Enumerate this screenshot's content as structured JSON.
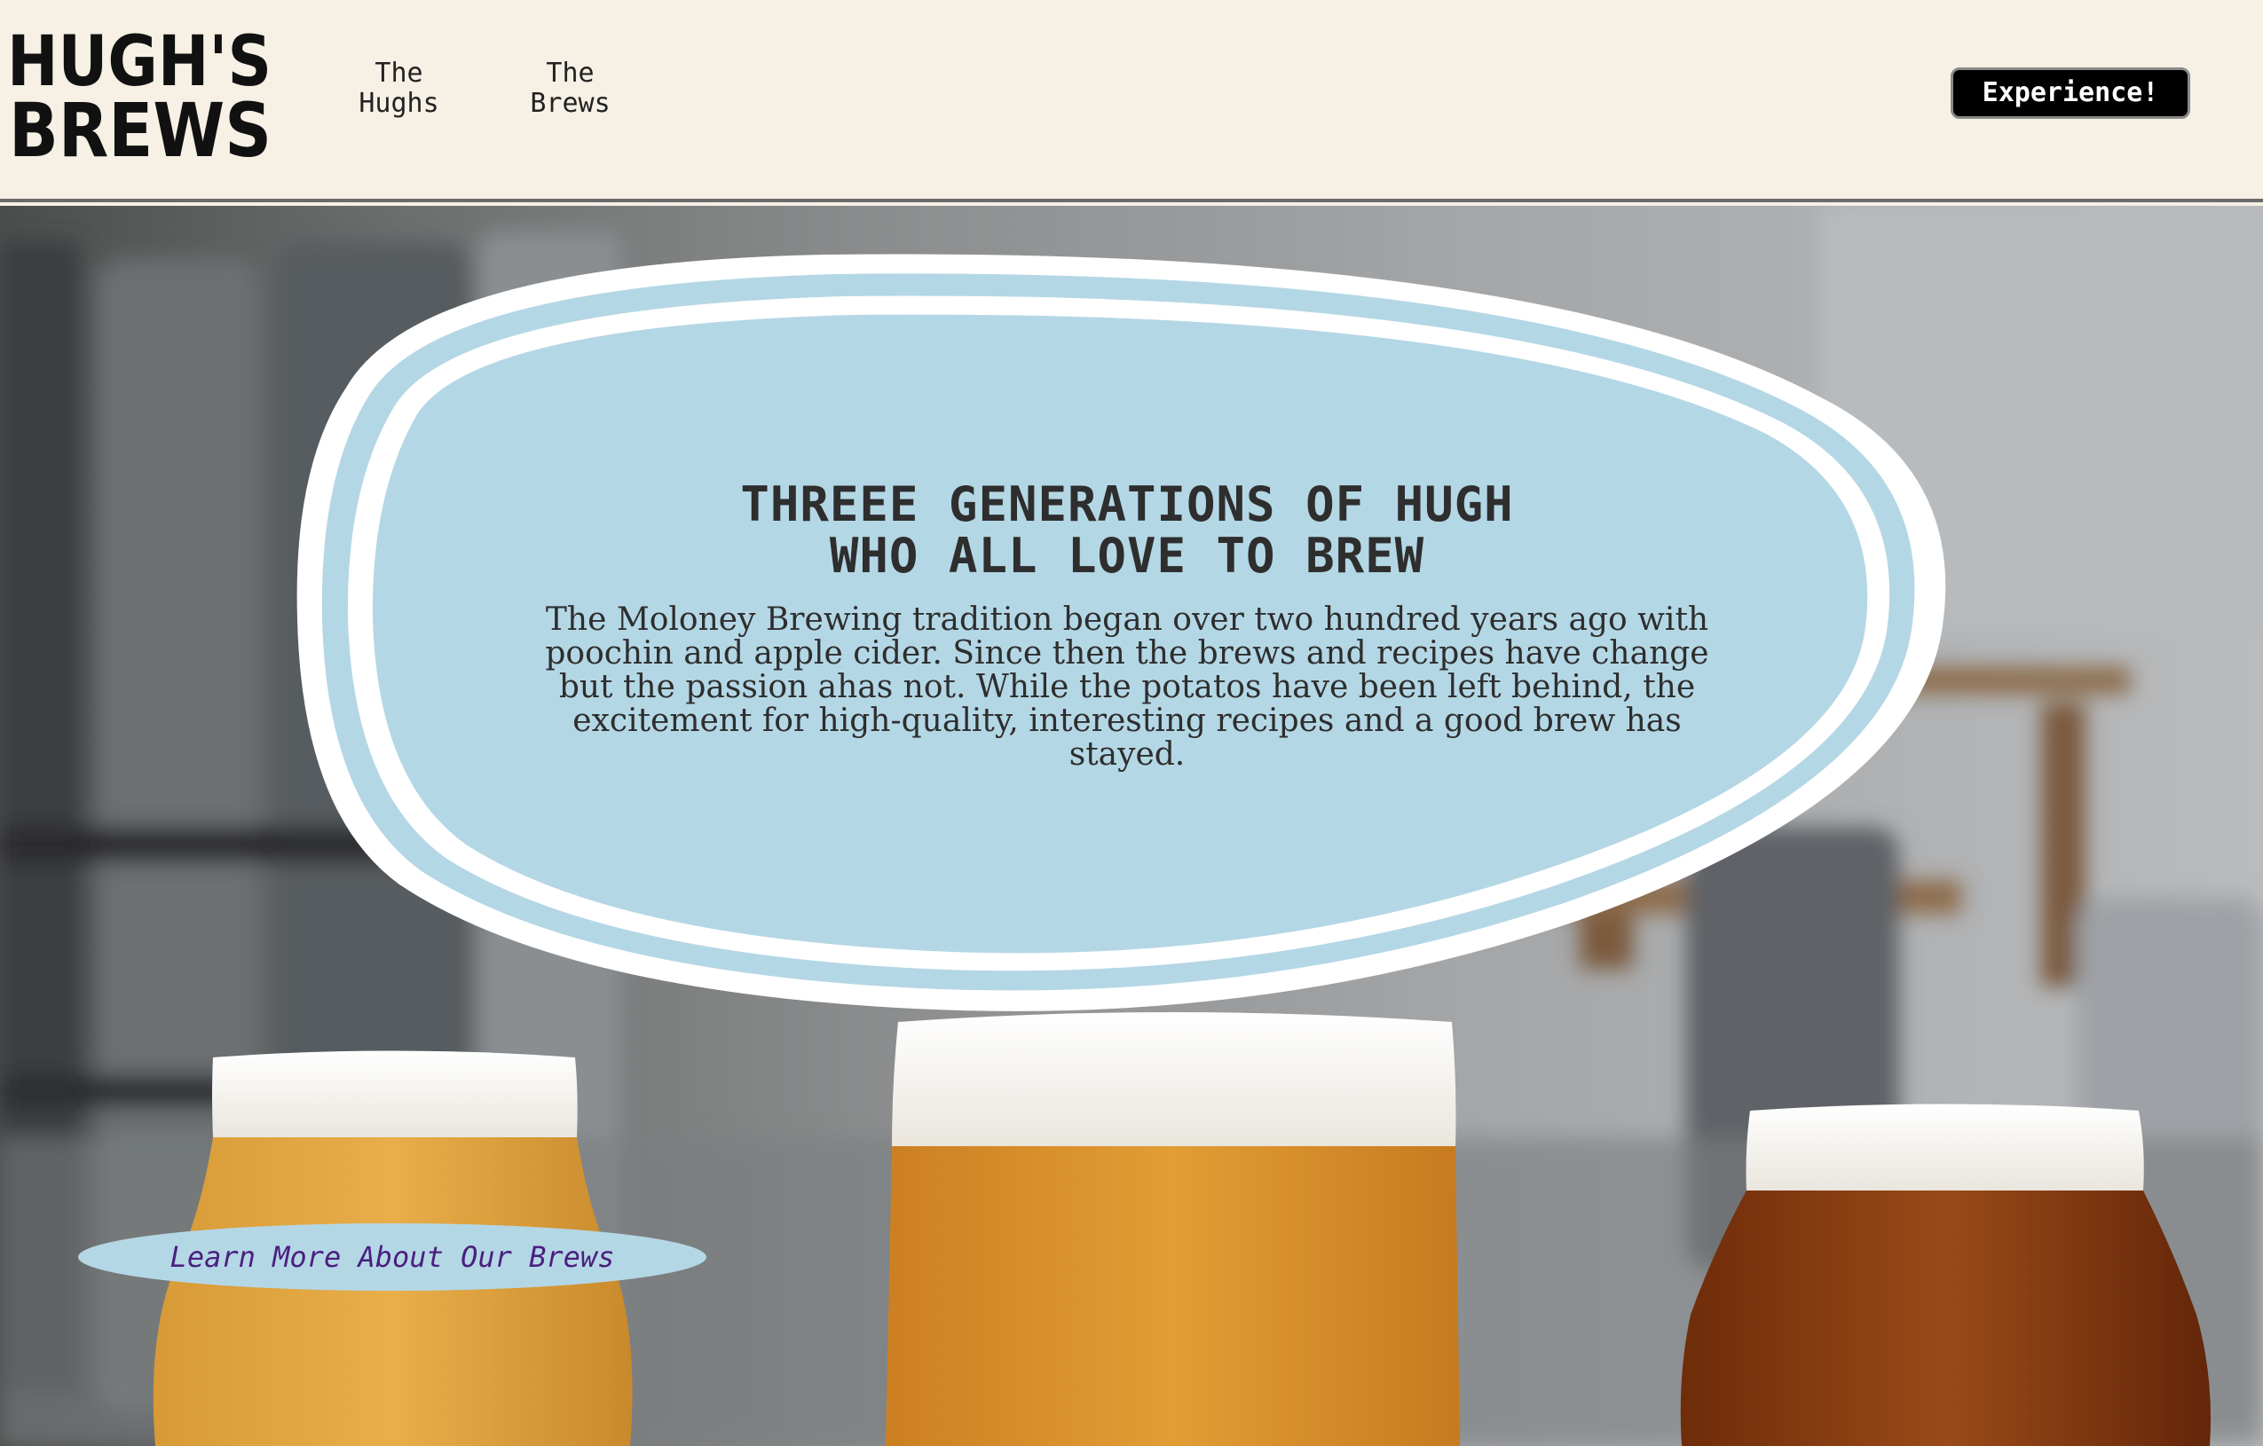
{
  "header": {
    "logo_text": "HUGH'S BREWS",
    "nav": [
      {
        "line1": "The",
        "line2": "Hughs"
      },
      {
        "line1": "The",
        "line2": "Brews"
      }
    ],
    "cta_label": "Experience!"
  },
  "hero": {
    "title_line1": "THREEE GENERATIONS OF HUGH",
    "title_line2": "WHO ALL LOVE TO BREW",
    "body": "The Moloney Brewing tradition began over two hundred years ago with poochin and apple cider. Since then the brews and recipes have change but the passion ahas not. While the potatos have been left behind, the excitement for high-quality, interesting recipes and a good brew has stayed.",
    "learn_more_label": "Learn More About Our Brews"
  },
  "colors": {
    "header_bg": "#f6f0e5",
    "blob_fill": "#b4d7e5",
    "cta_bg": "#000000",
    "link_text": "#4a1f80",
    "beer_light": "#e3a640",
    "beer_mid": "#dc962f",
    "beer_dark": "#8a3e12"
  }
}
